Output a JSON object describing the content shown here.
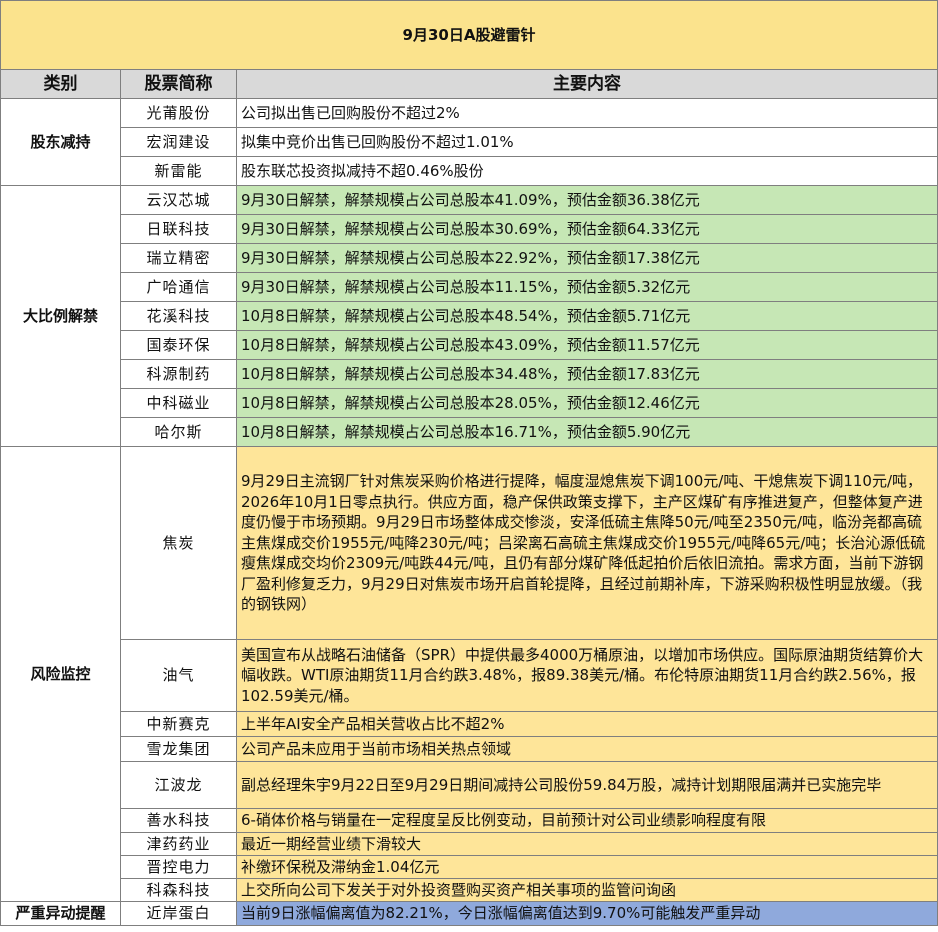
{
  "title": "9月30日A股避雷针",
  "header": {
    "category": "类别",
    "stock": "股票简称",
    "content": "主要内容"
  },
  "groups": [
    {
      "category": "股东减持",
      "rows": [
        {
          "name": "光莆股份",
          "text": "公司拟出售已回购股份不超过2%"
        },
        {
          "name": "宏润建设",
          "text": "拟集中竞价出售已回购股份不超过1.01%"
        },
        {
          "name": "新雷能",
          "text": "股东联芯投资拟减持不超0.46%股份"
        }
      ]
    },
    {
      "category": "大比例解禁",
      "rows": [
        {
          "name": "云汉芯城",
          "text": "9月30日解禁，解禁规模占公司总股本41.09%，预估金额36.38亿元"
        },
        {
          "name": "日联科技",
          "text": "9月30日解禁，解禁规模占公司总股本30.69%，预估金额64.33亿元"
        },
        {
          "name": "瑞立精密",
          "text": "9月30日解禁，解禁规模占公司总股本22.92%，预估金额17.38亿元"
        },
        {
          "name": "广哈通信",
          "text": "9月30日解禁，解禁规模占公司总股本11.15%，预估金额5.32亿元"
        },
        {
          "name": "花溪科技",
          "text": "10月8日解禁，解禁规模占公司总股本48.54%，预估金额5.71亿元"
        },
        {
          "name": "国泰环保",
          "text": "10月8日解禁，解禁规模占公司总股本43.09%，预估金额11.57亿元"
        },
        {
          "name": "科源制药",
          "text": "10月8日解禁，解禁规模占公司总股本34.48%，预估金额17.83亿元"
        },
        {
          "name": "中科磁业",
          "text": "10月8日解禁，解禁规模占公司总股本28.05%，预估金额12.46亿元"
        },
        {
          "name": "哈尔斯",
          "text": "10月8日解禁，解禁规模占公司总股本16.71%，预估金额5.90亿元"
        }
      ]
    },
    {
      "category": "风险监控",
      "rows": [
        {
          "name": "焦炭",
          "text": "9月29日主流钢厂针对焦炭采购价格进行提降，幅度湿熄焦炭下调100元/吨、干熄焦炭下调110元/吨，2026年10月1日零点执行。供应方面，稳产保供政策支撑下，主产区煤矿有序推进复产，但整体复产进度仍慢于市场预期。9月29日市场整体成交惨淡，安泽低硫主焦降50元/吨至2350元/吨，临汾尧都高硫主焦煤成交价1955元/吨降230元/吨；吕梁离石高硫主焦煤成交价1955元/吨降65元/吨；长治沁源低硫瘦焦煤成交均价2309元/吨跌44元/吨，且仍有部分煤矿降低起拍价后依旧流拍。需求方面，当前下游钢厂盈利修复乏力，9月29日对焦炭市场开启首轮提降，且经过前期补库，下游采购积极性明显放缓。（我的钢铁网）"
        },
        {
          "name": "油气",
          "text": "美国宣布从战略石油储备（SPR）中提供最多4000万桶原油，以增加市场供应。国际原油期货结算价大幅收跌。WTI原油期货11月合约跌3.48%，报89.38美元/桶。布伦特原油期货11月合约跌2.56%，报102.59美元/桶。"
        },
        {
          "name": "中新赛克",
          "text": "上半年AI安全产品相关营收占比不超2%"
        },
        {
          "name": "雪龙集团",
          "text": "公司产品未应用于当前市场相关热点领域"
        },
        {
          "name": "江波龙",
          "text": "副总经理朱宇9月22日至9月29日期间减持公司股份59.84万股，减持计划期限届满并已实施完毕"
        },
        {
          "name": "善水科技",
          "text": "6-硝体价格与销量在一定程度呈反比例变动，目前预计对公司业绩影响程度有限"
        },
        {
          "name": "津药药业",
          "text": "最近一期经营业绩下滑较大"
        },
        {
          "name": "晋控电力",
          "text": "补缴环保税及滞纳金1.04亿元"
        },
        {
          "name": "科森科技",
          "text": "上交所向公司下发关于对外投资暨购买资产相关事项的监管问询函"
        }
      ]
    },
    {
      "category": "严重异动提醒",
      "rows": [
        {
          "name": "近岸蛋白",
          "text": "当前9日涨幅偏离值为82.21%，今日涨幅偏离值达到9.70%可能触发严重异动"
        }
      ]
    }
  ],
  "colors": {
    "title_bg": "#fbe38d",
    "title_text": "#e3001b",
    "header_bg": "#d9d9d9",
    "category_text": "#e3001b",
    "unlock_bg": "#c6e7b5",
    "risk_bg": "#fee599",
    "alert_bg": "#8fa9dc"
  }
}
